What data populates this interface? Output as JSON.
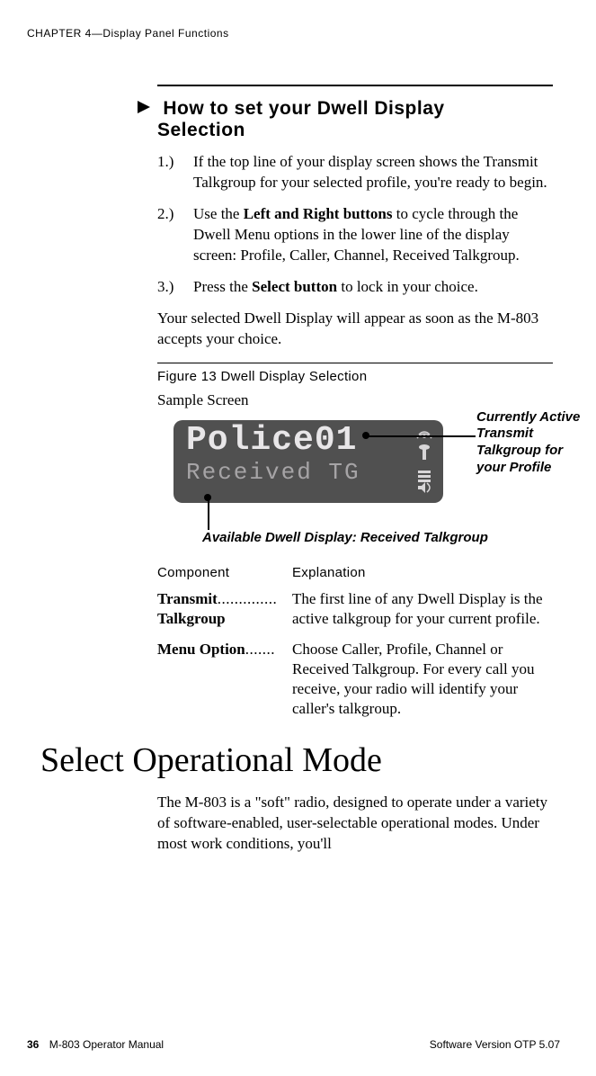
{
  "header": {
    "chapter_line": "CHAPTER 4—Display Panel Functions"
  },
  "section": {
    "title_line1": "How to set your Dwell Display",
    "title_line2": "Selection"
  },
  "steps": {
    "s1": {
      "num": "1.)",
      "text": "If the top line of your display screen shows the Transmit Talkgroup for your selected profile, you're ready to begin."
    },
    "s2": {
      "num": "2.)",
      "text_pre": "Use the ",
      "bold1": "Left and Right buttons",
      "text_post": " to cycle through the Dwell Menu options in the lower line of the display screen: Profile, Caller, Channel, Received Talkgroup."
    },
    "s3": {
      "num": "3.)",
      "text_pre": "Press the ",
      "bold1": "Select button",
      "text_post": " to lock in your choice."
    }
  },
  "confirm_p": "Your selected Dwell Display will appear as soon as the M-803 accepts your choice.",
  "figure": {
    "title": "Figure 13 Dwell Display Selection",
    "sample_label": "Sample Screen",
    "lcd_line1": "Police01",
    "lcd_line2": "Received TG",
    "annot_right": "Currently Active Transmit Talkgroup for your Profile",
    "annot_bottom": "Available Dwell Display: Received Talkgroup"
  },
  "table": {
    "head_c1": "Component",
    "head_c2": "Explanation",
    "r1_c1_bold1": "Transmit",
    "r1_c1_dots": "..............",
    "r1_c1_bold2": "Talkgroup",
    "r1_c2": "The first line of any Dwell Display is the active talkgroup for your current profile.",
    "r2_c1_bold1": "Menu Option",
    "r2_c1_dots": ".......",
    "r2_c2": "Choose Caller, Profile, Channel or Received Talkgroup. For every call you receive, your radio will identify your caller's talkgroup."
  },
  "h1": "Select Operational Mode",
  "last_p": "The M-803 is a \"soft\" radio, designed to operate under a variety of software-enabled, user-selectable operational modes. Under most work conditions, you'll",
  "footer": {
    "page_num": "36",
    "manual": "M-803 Operator Manual",
    "version": "Software Version OTP 5.07"
  }
}
